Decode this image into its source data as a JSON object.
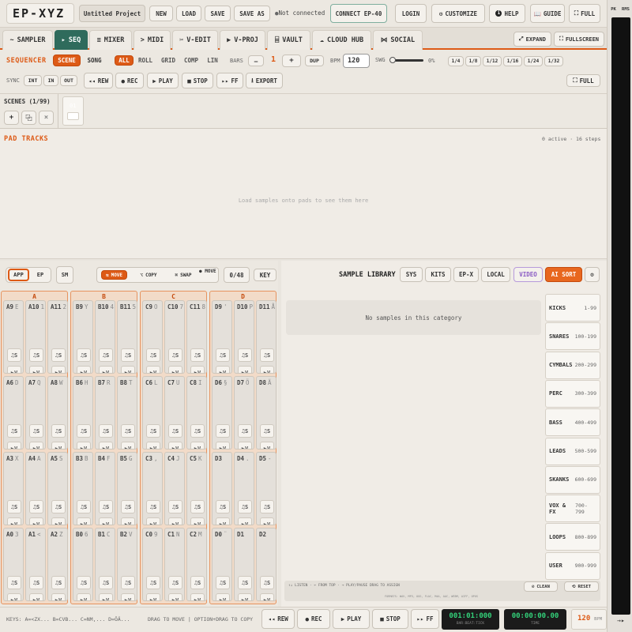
{
  "top": {
    "logo": "EP-XYZ",
    "project": "Untitled Project",
    "buttons": {
      "new": "NEW",
      "load": "LOAD",
      "save": "SAVE",
      "save_as": "SAVE AS"
    },
    "connection": "Not connected",
    "connect": "CONNECT EP-40",
    "login": "LOGIN",
    "customize": "CUSTOMIZE",
    "help": "HELP",
    "guide": "GUIDE",
    "full": "FULL"
  },
  "meters": {
    "pk": "PK",
    "rms": "RMS"
  },
  "tabs": [
    {
      "icon": "~",
      "label": "SAMPLER"
    },
    {
      "icon": "▸",
      "label": "SEQ"
    },
    {
      "icon": "≡",
      "label": "MIXER"
    },
    {
      "icon": ">",
      "label": "MIDI"
    },
    {
      "icon": "✂",
      "label": "V-EDIT"
    },
    {
      "icon": "▶",
      "label": "V-PROJ"
    },
    {
      "icon": "⌸",
      "label": "VAULT"
    },
    {
      "icon": "☁",
      "label": "CLOUD HUB"
    },
    {
      "icon": "⋈",
      "label": "SOCIAL"
    }
  ],
  "tabbar_right": {
    "expand": "EXPAND",
    "fullscreen": "FULLSCREEN"
  },
  "sequencer": {
    "title": "SEQUENCER",
    "modes": [
      "SCENE",
      "SONG"
    ],
    "views": [
      "ALL",
      "ROLL",
      "GRID",
      "COMP",
      "LIN"
    ],
    "bars_label": "BARS",
    "bars_minus": "—",
    "bars_value": "1",
    "bars_plus": "+",
    "dup": "DUP",
    "bpm_label": "BPM",
    "bpm_value": "120",
    "swg_label": "SWG",
    "swing_value": "0%",
    "swing_fraction": 0,
    "quant": [
      "1/4",
      "1/8",
      "1/12",
      "1/16",
      "1/24",
      "1/32"
    ],
    "sync_label": "SYNC",
    "sync_opts": [
      "INT",
      "IN",
      "OUT"
    ],
    "transport": {
      "rew": "REW",
      "rec": "REC",
      "play": "PLAY",
      "stop": "STOP",
      "ff": "FF",
      "export": "EXPORT"
    },
    "full": "FULL"
  },
  "scenes": {
    "title": "SCENES (1/99)",
    "add": "+",
    "copy": "⿻",
    "delete": "×",
    "scene1": "01"
  },
  "pad_tracks": {
    "title": "PAD TRACKS",
    "info": "0 active · 16 steps",
    "empty": "Load samples onto pads to see them here"
  },
  "pads_toolbar": {
    "app": "APP",
    "ep": "EP",
    "sm": "SM",
    "move": "MOVE",
    "copy": "COPY",
    "swap": "SWAP",
    "mode_status": "● MOVE",
    "count": "0/48",
    "key": "KEY"
  },
  "pad_icons": {
    "sample": "♫",
    "sample_label": "S",
    "play": "▶",
    "play_label": "V"
  },
  "banks": [
    {
      "name": "A",
      "pads": [
        {
          "id": "A9",
          "key": "E"
        },
        {
          "id": "A10",
          "key": "1"
        },
        {
          "id": "A11",
          "key": "2"
        },
        {
          "id": "A6",
          "key": "D"
        },
        {
          "id": "A7",
          "key": "Q"
        },
        {
          "id": "A8",
          "key": "W"
        },
        {
          "id": "A3",
          "key": "X"
        },
        {
          "id": "A4",
          "key": "A"
        },
        {
          "id": "A5",
          "key": "S"
        },
        {
          "id": "A0",
          "key": "3"
        },
        {
          "id": "A1",
          "key": "<"
        },
        {
          "id": "A2",
          "key": "Z"
        }
      ]
    },
    {
      "name": "B",
      "pads": [
        {
          "id": "B9",
          "key": "Y"
        },
        {
          "id": "B10",
          "key": "4"
        },
        {
          "id": "B11",
          "key": "5"
        },
        {
          "id": "B6",
          "key": "H"
        },
        {
          "id": "B7",
          "key": "R"
        },
        {
          "id": "B8",
          "key": "T"
        },
        {
          "id": "B3",
          "key": "B"
        },
        {
          "id": "B4",
          "key": "F"
        },
        {
          "id": "B5",
          "key": "G"
        },
        {
          "id": "B0",
          "key": "6"
        },
        {
          "id": "B1",
          "key": "C"
        },
        {
          "id": "B2",
          "key": "V"
        }
      ]
    },
    {
      "name": "C",
      "pads": [
        {
          "id": "C9",
          "key": "O"
        },
        {
          "id": "C10",
          "key": "7"
        },
        {
          "id": "C11",
          "key": "8"
        },
        {
          "id": "C6",
          "key": "L"
        },
        {
          "id": "C7",
          "key": "U"
        },
        {
          "id": "C8",
          "key": "I"
        },
        {
          "id": "C3",
          "key": ","
        },
        {
          "id": "C4",
          "key": "J"
        },
        {
          "id": "C5",
          "key": "K"
        },
        {
          "id": "C0",
          "key": "9"
        },
        {
          "id": "C1",
          "key": "N"
        },
        {
          "id": "C2",
          "key": "M"
        }
      ]
    },
    {
      "name": "D",
      "pads": [
        {
          "id": "D9",
          "key": "'"
        },
        {
          "id": "D10",
          "key": "P"
        },
        {
          "id": "D11",
          "key": "Å"
        },
        {
          "id": "D6",
          "key": "§"
        },
        {
          "id": "D7",
          "key": "Ö"
        },
        {
          "id": "D8",
          "key": "Ä"
        },
        {
          "id": "D3",
          "key": ""
        },
        {
          "id": "D4",
          "key": "."
        },
        {
          "id": "D5",
          "key": "-"
        },
        {
          "id": "D0",
          "key": "¨"
        },
        {
          "id": "D1",
          "key": ""
        },
        {
          "id": "D2",
          "key": ""
        }
      ]
    }
  ],
  "library": {
    "title": "SAMPLE LIBRARY",
    "sources": [
      "SYS",
      "KITS",
      "EP-X",
      "LOCAL"
    ],
    "video": "VIDEO",
    "ai_sort": "AI SORT",
    "empty": "No samples in this category",
    "categories": [
      {
        "name": "KICKS",
        "range": "1-99"
      },
      {
        "name": "SNARES",
        "range": "100-199"
      },
      {
        "name": "CYMBALS",
        "range": "200-299"
      },
      {
        "name": "PERC",
        "range": "300-399"
      },
      {
        "name": "BASS",
        "range": "400-499"
      },
      {
        "name": "LEADS",
        "range": "500-599"
      },
      {
        "name": "SKANKS",
        "range": "600-699"
      },
      {
        "name": "VOX & FX",
        "range": "700-799"
      },
      {
        "name": "LOOPS",
        "range": "800-899"
      },
      {
        "name": "USER",
        "range": "900-999"
      }
    ],
    "hints": "↑↓ LISTEN · ← FROM TOP · → PLAY/PAUSE  DRAG TO ASSIGN",
    "formats": "FORMATS: WAV, MP3, OGG, FLAC, M4A, AAC, WEBM, AIFF, OPUS",
    "clean": "CLEAN",
    "reset": "RESET"
  },
  "footer": {
    "keys": "KEYS: A=<ZX... B=CVB... C=NM,... D=ÖÄ...",
    "drag": "DRAG TO MOVE | OPTION+DRAG TO COPY",
    "rew": "REW",
    "rec": "REC",
    "play": "PLAY",
    "stop": "STOP",
    "ff": "FF",
    "position": "001:01:000",
    "position_label": "BAR:BEAT:TICK",
    "time": "00:00:00.00",
    "time_label": "TIME",
    "bpm": "120",
    "bpm_label": "BPM"
  },
  "colors": {
    "accent": "#dd5a16",
    "seq_tab": "#2f6b5c",
    "lcd_text": "#33d17a",
    "video": "#8b5cc4"
  }
}
